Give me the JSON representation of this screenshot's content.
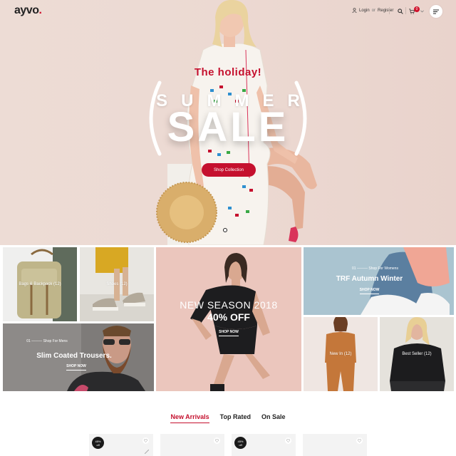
{
  "header": {
    "logo_text": "ayvo",
    "logo_dot": ".",
    "login_label": "Login",
    "or_label": "or",
    "register_label": "Register",
    "cart_count": "0",
    "icons": [
      "user-icon",
      "search-icon",
      "cart-icon",
      "chevron-down-icon",
      "menu-icon"
    ]
  },
  "hero": {
    "kicker": "The holiday!",
    "line1": "SUMMER",
    "line2": "SALE",
    "button_label": "Shop Collection",
    "accent_color": "#c5102e"
  },
  "banners": {
    "backpack": {
      "label": "Bags & Backpack (12)"
    },
    "shoes": {
      "label": "Shoes (12)"
    },
    "trousers": {
      "number": "01",
      "small": "Shop For Mens",
      "title": "Slim Coated Trousers.",
      "link": "SHOP NOW"
    },
    "newseason": {
      "title": "NEW SEASON 2018",
      "subtitle": "40% OFF",
      "link": "SHOP NOW"
    },
    "trf": {
      "number": "01",
      "small": "Shop For Womens",
      "title": "TRF Autumn Winter",
      "link": "SHOP NOW"
    },
    "newin": {
      "label": "New In (12)"
    },
    "bestseller": {
      "label": "Best Seller (12)"
    }
  },
  "tabs": [
    {
      "label": "New Arrivals",
      "active": true
    },
    {
      "label": "Top Rated",
      "active": false
    },
    {
      "label": "On Sale",
      "active": false
    }
  ],
  "products": [
    {
      "badge_pct": "45%",
      "badge_off": "off",
      "has_badge": true
    },
    {
      "has_badge": false
    },
    {
      "badge_pct": "45%",
      "badge_off": "off",
      "has_badge": true
    },
    {
      "has_badge": false
    }
  ]
}
